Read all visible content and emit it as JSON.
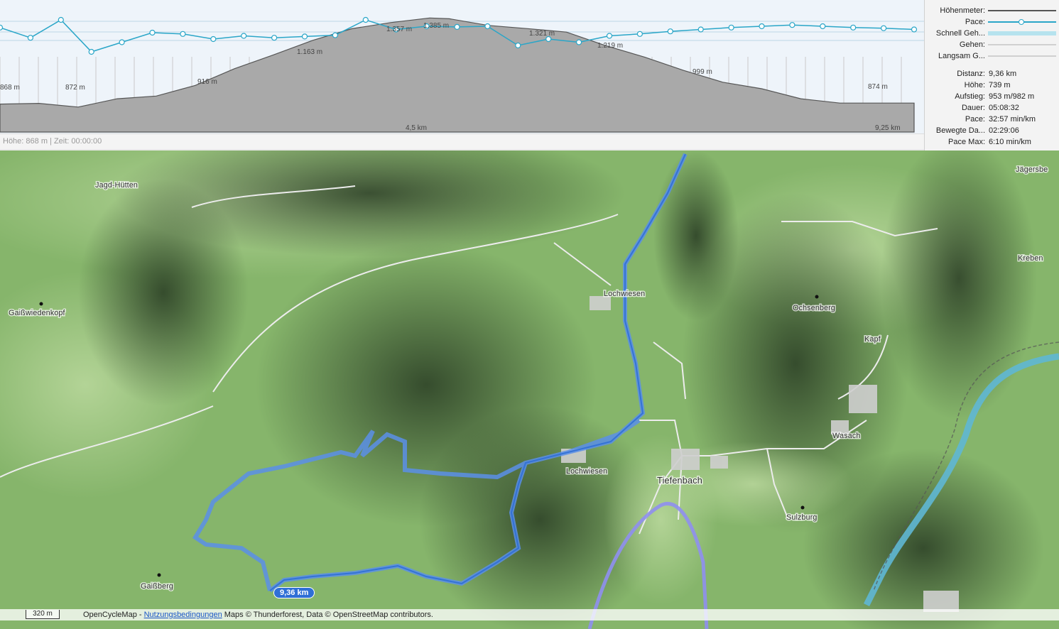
{
  "elevation_chart": {
    "profile_labels": [
      "868 m",
      "872 m",
      "916 m",
      "1.163 m",
      "1.357 m",
      "1.385 m",
      "1.321 m",
      "1.219 m",
      "999 m",
      "874 m"
    ],
    "distance_ticks": [
      "4,5 km",
      "9,25 km"
    ],
    "profile": {
      "x": [
        0.0,
        0.4,
        0.8,
        1.2,
        1.6,
        2.0,
        2.4,
        2.8,
        3.2,
        3.6,
        4.0,
        4.4,
        4.6,
        5.0,
        5.4,
        5.8,
        6.2,
        6.6,
        7.0,
        7.4,
        7.8,
        8.2,
        8.6,
        9.0,
        9.36
      ],
      "y": [
        868,
        872,
        850,
        900,
        916,
        980,
        1080,
        1163,
        1250,
        1320,
        1357,
        1385,
        1380,
        1340,
        1321,
        1300,
        1219,
        1150,
        1070,
        999,
        960,
        900,
        874,
        874,
        874
      ]
    },
    "pace_points": [
      32,
      48,
      20,
      70,
      55,
      40,
      42,
      50,
      45,
      48,
      46,
      44,
      20,
      35,
      30,
      31,
      30,
      60,
      50,
      55,
      45,
      42,
      38,
      35,
      32,
      30,
      28,
      30,
      32,
      33,
      35
    ]
  },
  "status_bar": "Höhe: 868 m | Zeit: 00:00:00",
  "legend": [
    {
      "label": "Höhenmeter:",
      "color": "#555555"
    },
    {
      "label": "Pace:",
      "color": "#2aa6c8"
    },
    {
      "label": "Schnell Geh...",
      "color": "#b6e3ee"
    },
    {
      "label": "Gehen:",
      "color": "#d0d0d0"
    },
    {
      "label": "Langsam G...",
      "color": "#d0d0d0"
    }
  ],
  "stats": [
    {
      "label": "Distanz:",
      "value": "9,36 km"
    },
    {
      "label": "Höhe:",
      "value": "739 m"
    },
    {
      "label": "Aufstieg:",
      "value": "953 m/982 m"
    },
    {
      "label": "Dauer:",
      "value": "05:08:32"
    },
    {
      "label": "Pace:",
      "value": "32:57 min/km"
    },
    {
      "label": "Bewegte Da...",
      "value": "02:29:06"
    },
    {
      "label": "Pace Max:",
      "value": "6:10 min/km"
    }
  ],
  "map": {
    "places": [
      "Jagd-Hütten",
      "Gaißwiedenkopf",
      "Lochwiesen",
      "Ochsenberg",
      "Kreben",
      "Jägersbe",
      "Kapf",
      "Wasach",
      "Lochwiesen",
      "Tiefenbach",
      "Sulzburg",
      "Gaißberg"
    ],
    "distance_badge": "9,36 km",
    "scale": "320 m",
    "attribution_prefix": "OpenCycleMap - ",
    "attribution_link": "Nutzungsbedingungen",
    "attribution_suffix": " Maps © Thunderforest, Data © OpenStreetMap contributors."
  }
}
